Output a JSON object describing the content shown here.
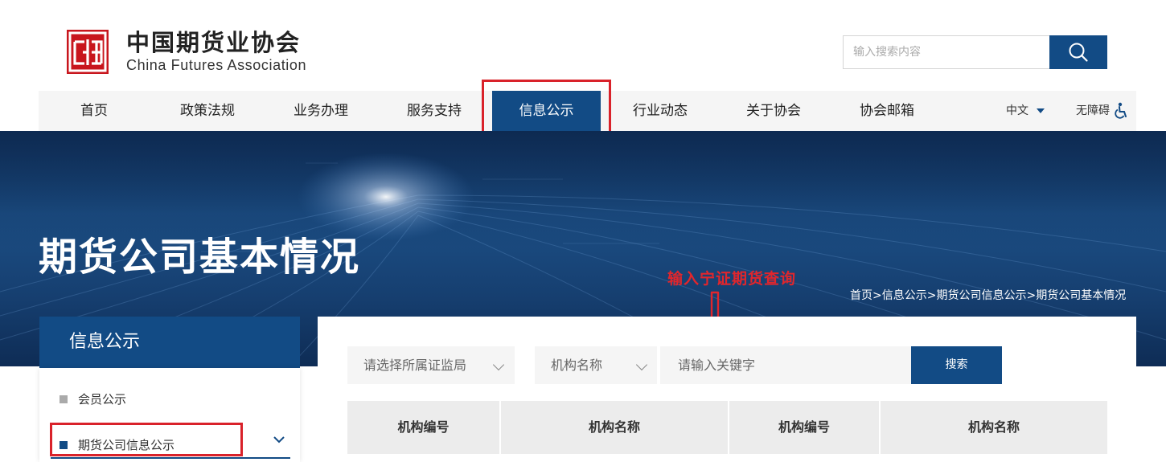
{
  "header": {
    "logo_cn": "中国期货业协会",
    "logo_en": "China Futures Association",
    "search_placeholder": "输入搜索内容",
    "logo_icon": "cfa-logo-mark",
    "search_icon": "search-icon"
  },
  "nav": {
    "items": [
      "首页",
      "政策法规",
      "业务办理",
      "服务支持",
      "信息公示",
      "行业动态",
      "关于协会",
      "协会邮箱"
    ],
    "active": "信息公示",
    "language": "中文",
    "accessibility": "无障碍",
    "accessibility_icon": "wheelchair-icon"
  },
  "banner": {
    "title": "期货公司基本情况",
    "breadcrumb": "首页>信息公示>期货公司信息公示>期货公司基本情况"
  },
  "annotation": {
    "text": "输入宁证期货查询",
    "color": "#e1262c"
  },
  "sidebar": {
    "title": "信息公示",
    "items": [
      "会员公示",
      "期货公司信息公示"
    ],
    "active": "期货公司信息公示"
  },
  "filters": {
    "regulator_select": "请选择所属证监局",
    "field_select": "机构名称",
    "keyword_placeholder": "请输入关键字",
    "search_button": "搜索"
  },
  "table": {
    "headers": [
      "机构编号",
      "机构名称",
      "机构编号",
      "机构名称"
    ]
  },
  "colors": {
    "primary": "#124b85",
    "logo_red": "#c8161d",
    "highlight_red": "#d9222a"
  }
}
